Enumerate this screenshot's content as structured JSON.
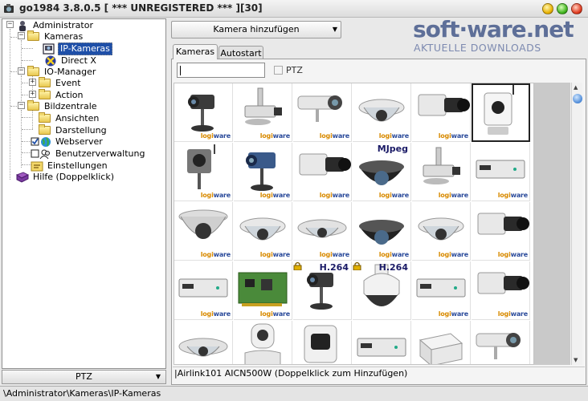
{
  "window": {
    "title": "go1984 3.8.0.5 [ *** UNREGISTERED *** ][30]"
  },
  "tree": {
    "items": [
      {
        "label": "Administrator",
        "icon": "admin-user-icon"
      },
      {
        "label": "Kameras",
        "icon": "folder-icon"
      },
      {
        "label": "IP-Kameras",
        "icon": "ip-camera-icon",
        "selected": true
      },
      {
        "label": "Direct X",
        "icon": "directx-icon"
      },
      {
        "label": "IO-Manager",
        "icon": "folder-icon"
      },
      {
        "label": "Event",
        "icon": "folder-icon"
      },
      {
        "label": "Action",
        "icon": "folder-icon"
      },
      {
        "label": "Bildzentrale",
        "icon": "folder-icon"
      },
      {
        "label": "Ansichten",
        "icon": "folder-icon"
      },
      {
        "label": "Darstellung",
        "icon": "folder-icon"
      },
      {
        "label": "Webserver",
        "icon": "globe-icon"
      },
      {
        "label": "Benutzerverwaltung",
        "icon": "users-icon"
      },
      {
        "label": "Einstellungen",
        "icon": "settings-icon"
      },
      {
        "label": "Hilfe (Doppelklick)",
        "icon": "help-book-icon"
      }
    ]
  },
  "ptz_bar": {
    "label": "PTZ"
  },
  "status_bar": {
    "path": "\\Administrator\\Kameras\\IP-Kameras"
  },
  "toolbar": {
    "add_camera_label": "Kamera hinzufügen"
  },
  "watermark": {
    "main": "soft·ware.net",
    "sub": "AKTUELLE DOWNLOADS"
  },
  "tabs": [
    {
      "label": "Kameras",
      "active": true
    },
    {
      "label": "Autostart",
      "active": false
    }
  ],
  "filter": {
    "search_value": "",
    "ptz_label": "PTZ",
    "ptz_checked": false
  },
  "camera_grid": {
    "logo_text": {
      "a": "logi",
      "b": "ware"
    },
    "cells": [
      {
        "name": "camera-thumb",
        "kind": "box-stand",
        "logo": true
      },
      {
        "name": "camera-thumb",
        "kind": "ceiling-mount",
        "logo": true
      },
      {
        "name": "camera-thumb",
        "kind": "bullet",
        "logo": true
      },
      {
        "name": "camera-thumb",
        "kind": "dome",
        "logo": true
      },
      {
        "name": "camera-thumb",
        "kind": "box-lens",
        "logo": true
      },
      {
        "name": "camera-thumb",
        "kind": "cube-wifi",
        "logo": false,
        "selected": true
      },
      {
        "name": "camera-thumb",
        "kind": "cube-stand",
        "logo": true
      },
      {
        "name": "camera-thumb",
        "kind": "box-stand-blue",
        "logo": true
      },
      {
        "name": "camera-thumb",
        "kind": "box-lens",
        "logo": true
      },
      {
        "name": "camera-thumb",
        "kind": "dome-black",
        "logo": true,
        "tag": "MJpeg"
      },
      {
        "name": "camera-thumb",
        "kind": "ceiling-mount",
        "logo": true
      },
      {
        "name": "camera-thumb",
        "kind": "server-box",
        "logo": true
      },
      {
        "name": "camera-thumb",
        "kind": "dome-large",
        "logo": true
      },
      {
        "name": "camera-thumb",
        "kind": "dome",
        "logo": true
      },
      {
        "name": "camera-thumb",
        "kind": "dome-flat",
        "logo": true
      },
      {
        "name": "camera-thumb",
        "kind": "dome-black",
        "logo": true
      },
      {
        "name": "camera-thumb",
        "kind": "dome",
        "logo": true
      },
      {
        "name": "camera-thumb",
        "kind": "box-lens",
        "logo": true
      },
      {
        "name": "camera-thumb",
        "kind": "server-box",
        "logo": true
      },
      {
        "name": "camera-thumb",
        "kind": "pcb",
        "logo": true
      },
      {
        "name": "camera-thumb",
        "kind": "box-stand",
        "logo": false,
        "lock": true,
        "tag": "H.264"
      },
      {
        "name": "camera-thumb",
        "kind": "dome-ptz",
        "logo": false,
        "lock": true,
        "tag": "H.264"
      },
      {
        "name": "camera-thumb",
        "kind": "server-box",
        "logo": true
      },
      {
        "name": "camera-thumb",
        "kind": "box-lens",
        "logo": true
      },
      {
        "name": "camera-thumb",
        "kind": "dome-flat",
        "logo": false
      },
      {
        "name": "camera-thumb",
        "kind": "ptz-white",
        "logo": false
      },
      {
        "name": "camera-thumb",
        "kind": "cube-white",
        "logo": false
      },
      {
        "name": "camera-thumb",
        "kind": "server-box",
        "logo": false
      },
      {
        "name": "camera-thumb",
        "kind": "box-white",
        "logo": false
      },
      {
        "name": "camera-thumb",
        "kind": "bullet",
        "logo": false
      }
    ]
  },
  "info_line": {
    "text": "|Airlink101 AICN500W (Doppelklick zum Hinzufügen)"
  },
  "colors": {
    "selection": "#1e4fa8",
    "logo_orange": "#d88a00",
    "logo_blue": "#2a4a9a",
    "watermark": "#5e6f98"
  }
}
